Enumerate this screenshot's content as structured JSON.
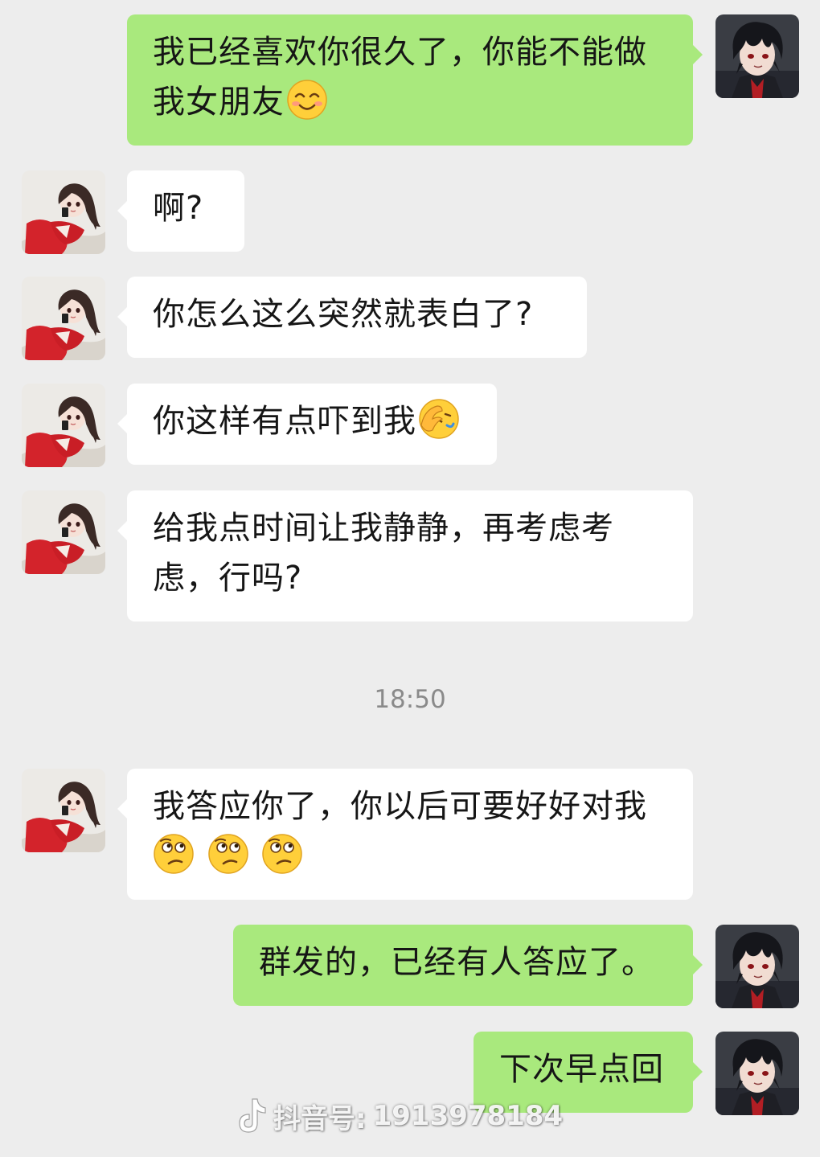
{
  "messages": [
    {
      "side": "right",
      "text": "我已经喜欢你很久了，你能不能做我女朋友",
      "emoji": "blush-emoji"
    },
    {
      "side": "left",
      "text": "啊?"
    },
    {
      "side": "left",
      "text": "你怎么这么突然就表白了?"
    },
    {
      "side": "left",
      "text": "你这样有点吓到我",
      "emoji": "facepalm-emoji"
    },
    {
      "side": "left",
      "text": "给我点时间让我静静，再考虑考虑，行吗?"
    },
    {
      "side": "left",
      "text": "我答应你了，你以后可要好好对我",
      "emoji": "confused-emoji x3"
    },
    {
      "side": "right",
      "text": "群发的，已经有人答应了。"
    },
    {
      "side": "right",
      "text": "下次早点回"
    }
  ],
  "timestamp": "18:50",
  "watermark": {
    "brand": "抖音号:",
    "id": "1913978184"
  },
  "colors": {
    "background": "#ededed",
    "sent_bubble": "#a9e97d",
    "received_bubble": "#ffffff",
    "timestamp_text": "#8a8a8a"
  }
}
